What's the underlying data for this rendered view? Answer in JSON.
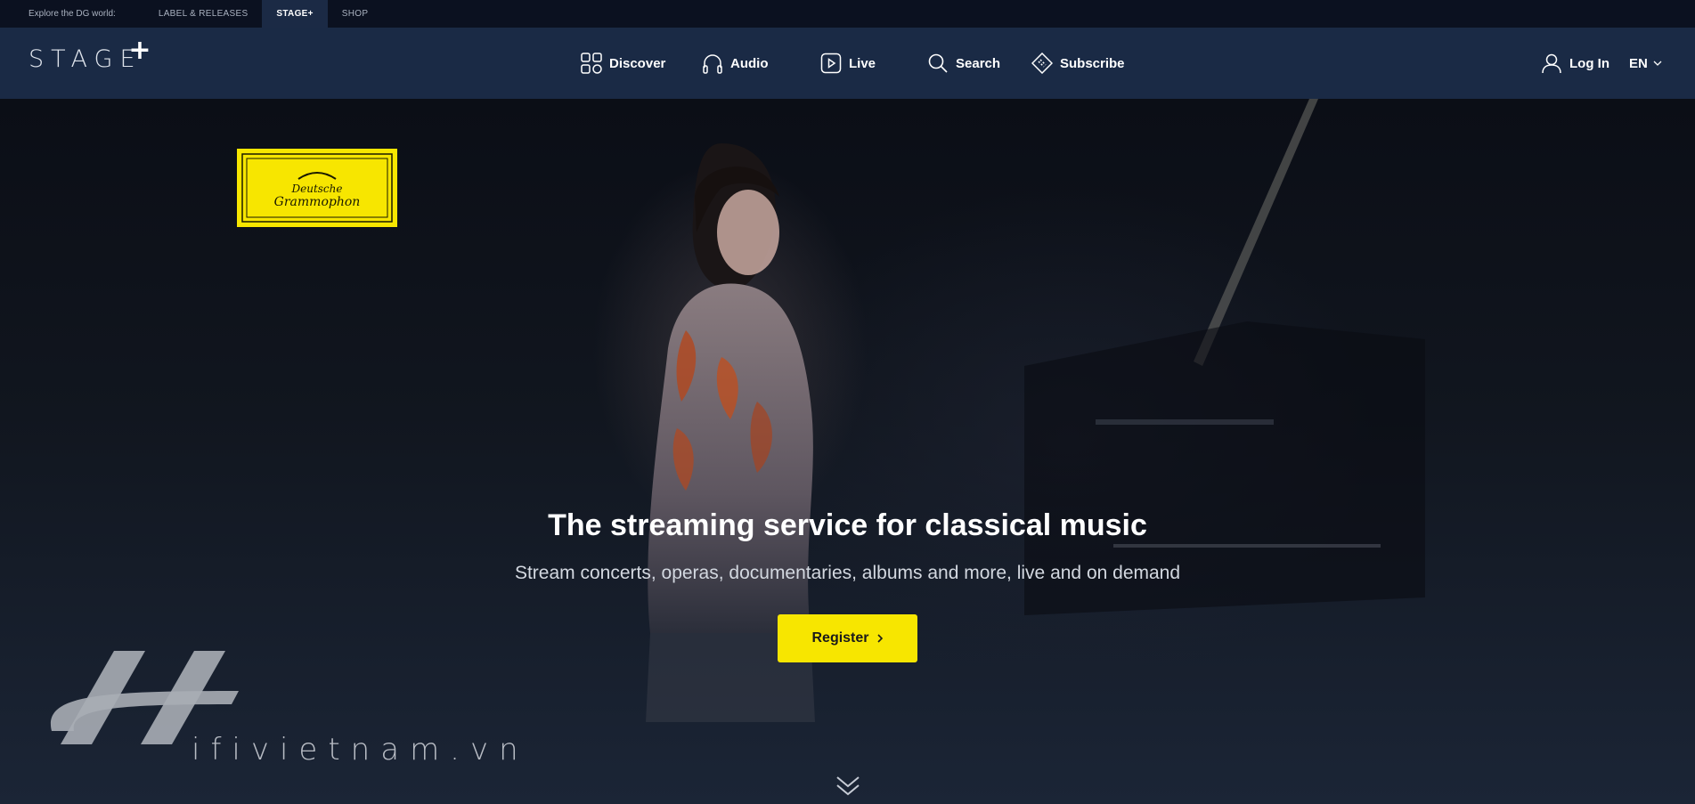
{
  "topbar": {
    "explore_label": "Explore the DG world:",
    "links": [
      {
        "label": "LABEL & RELEASES"
      },
      {
        "label": "STAGE+"
      },
      {
        "label": "SHOP"
      }
    ]
  },
  "nav": {
    "logo_text": "STAGE",
    "logo_plus": "+",
    "items": [
      {
        "label": "Discover",
        "icon": "grid-icon"
      },
      {
        "label": "Audio",
        "icon": "headphones-icon"
      },
      {
        "label": "Live",
        "icon": "play-icon"
      },
      {
        "label": "Search",
        "icon": "search-icon"
      },
      {
        "label": "Subscribe",
        "icon": "ticket-icon"
      }
    ],
    "login_label": "Log In",
    "language": "EN"
  },
  "hero": {
    "dg_logo_line1": "Deutsche",
    "dg_logo_line2": "Grammophon",
    "headline": "The streaming service for classical music",
    "subheadline": "Stream concerts, operas, documentaries, albums and more, live and on demand",
    "register_label": "Register"
  },
  "watermark": {
    "text": "ifivietnam.vn"
  },
  "colors": {
    "accent_yellow": "#f7e600",
    "nav_bg": "#1a2a45",
    "topbar_bg": "#0b1120"
  }
}
